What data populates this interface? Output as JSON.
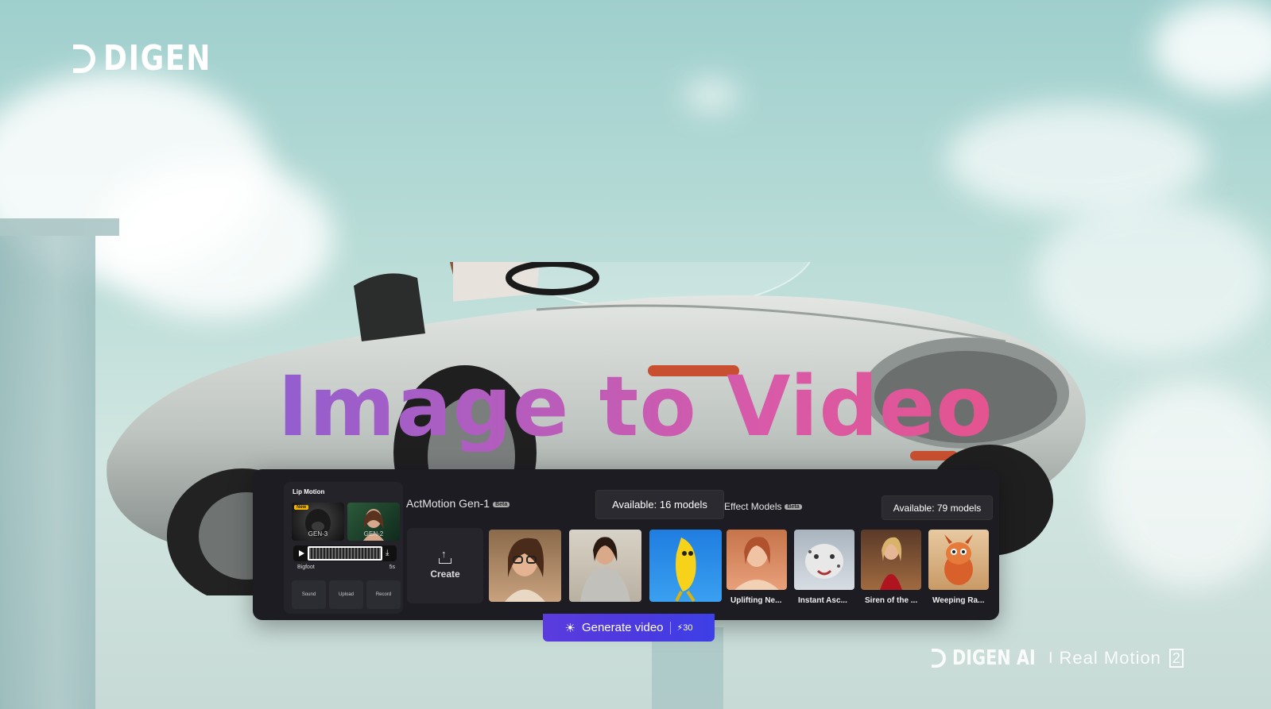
{
  "brand": {
    "logo_text": "DIGEN"
  },
  "headline": "Image to Video",
  "lip_motion": {
    "title": "Lip Motion",
    "thumbs": [
      {
        "label": "GEN-3",
        "badge": "New"
      },
      {
        "label": "GEN-2"
      }
    ],
    "track_name": "Bigfoot",
    "track_time": "5s",
    "buttons": [
      "Sound",
      "Upload",
      "Record"
    ]
  },
  "actmotion": {
    "title": "ActMotion Gen-1",
    "beta": "Beta",
    "available": "Available: 16 models",
    "create_label": "Create"
  },
  "effect_models": {
    "title": "Effect Models",
    "beta": "Beta",
    "available": "Available: 79 models",
    "items": [
      "Uplifting Ne...",
      "Instant Asc...",
      "Siren of the ...",
      "Weeping Ra..."
    ]
  },
  "generate": {
    "label": "Generate video",
    "credits": "30"
  },
  "watermark": {
    "brand": "DIGEN AI",
    "separator": "I",
    "product": "Real Motion",
    "version": "2"
  },
  "colors": {
    "panel": "#1c1c22",
    "generate_button": "#4a3ae0",
    "headline_gradient": [
      "#6a5ce0",
      "#d85aa8",
      "#ec4f7e"
    ]
  }
}
